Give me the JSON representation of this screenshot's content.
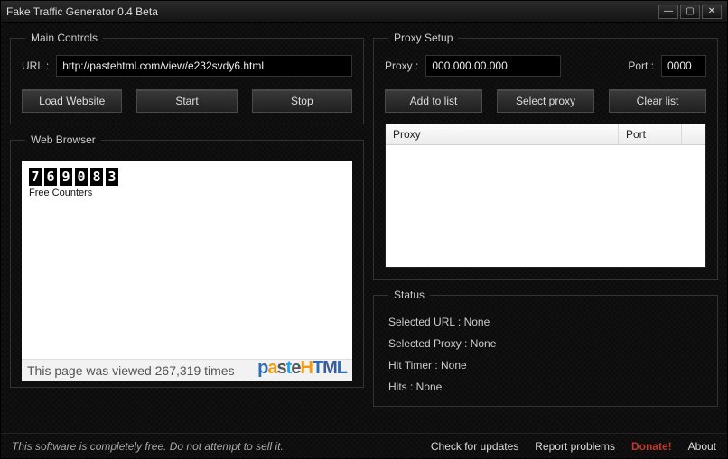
{
  "window": {
    "title": "Fake Traffic Generator 0.4 Beta"
  },
  "main": {
    "legend": "Main Controls",
    "url_label": "URL :",
    "url_value": "http://pastehtml.com/view/e232svdy6.html",
    "load_btn": "Load Website",
    "start_btn": "Start",
    "stop_btn": "Stop"
  },
  "browser": {
    "legend": "Web Browser",
    "counter_digits": [
      "7",
      "6",
      "9",
      "0",
      "8",
      "3"
    ],
    "counter_sub": "Free Counters",
    "status_text": "This page was viewed 267,319 times",
    "logo_text": "pasteHTML"
  },
  "proxy": {
    "legend": "Proxy Setup",
    "proxy_label": "Proxy :",
    "proxy_value": "000.000.00.000",
    "port_label": "Port :",
    "port_value": "0000",
    "add_btn": "Add to list",
    "select_btn": "Select proxy",
    "clear_btn": "Clear list",
    "col_proxy": "Proxy",
    "col_port": "Port"
  },
  "status": {
    "legend": "Status",
    "selected_url": "Selected URL :  None",
    "selected_proxy": "Selected Proxy :  None",
    "hit_timer": "Hit Timer :  None",
    "hits": "Hits :  None"
  },
  "footer": {
    "note": "This software is completely free. Do not attempt to sell it.",
    "check": "Check for updates",
    "report": "Report problems",
    "donate": "Donate!",
    "about": "About"
  }
}
